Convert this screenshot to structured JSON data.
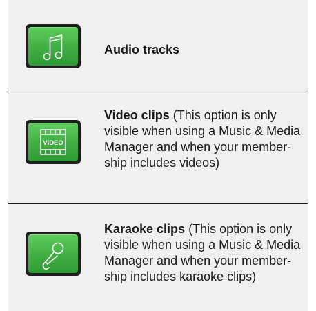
{
  "items": [
    {
      "title": "Audio tracks",
      "description": "",
      "icon": "music-note-icon"
    },
    {
      "title": "Video clips",
      "description": " (This option is only visible when using a Music & Media Manager and when your member-ship includes videos)",
      "icon": "video-icon",
      "icon_text": "VIDEO"
    },
    {
      "title": "Karaoke clips",
      "description": " (This option is only visible when using a Music & Media Manager and when your member-ship includes karaoke clips)",
      "icon": "microphone-icon"
    }
  ],
  "colors": {
    "panel_bg": "#f0f0f0",
    "tile_green": "#3fae42",
    "tile_border": "#1e1e1e",
    "text": "#1a1a1a"
  }
}
